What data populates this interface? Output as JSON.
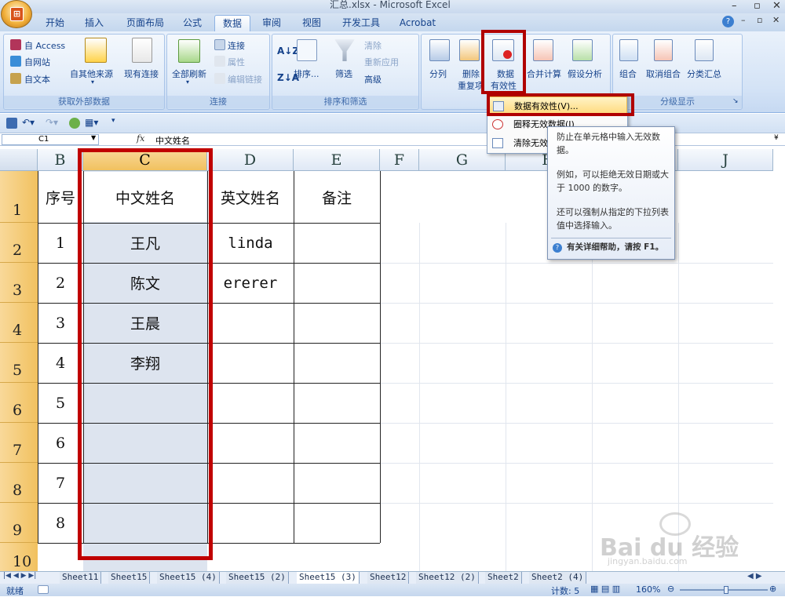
{
  "window": {
    "title": "汇总.xlsx - Microsoft Excel"
  },
  "tabs": [
    "开始",
    "插入",
    "页面布局",
    "公式",
    "数据",
    "审阅",
    "视图",
    "开发工具",
    "Acrobat"
  ],
  "ribbon": {
    "get_external": {
      "label": "获取外部数据",
      "access": "自 Access",
      "web": "自网站",
      "text": "自文本",
      "other": "自其他来源",
      "existing": "现有连接"
    },
    "connections": {
      "label": "连接",
      "refresh_all": "全部刷新",
      "connect": "连接",
      "props": "属性",
      "edit_links": "编辑链接"
    },
    "sort_filter": {
      "label": "排序和筛选",
      "sort": "排序...",
      "filter": "筛选",
      "clear": "清除",
      "reapply": "重新应用",
      "advanced": "高级"
    },
    "data_tools": {
      "split": "分列",
      "remove_dup_1": "删除",
      "remove_dup_2": "重复项",
      "validation_1": "数据",
      "validation_2": "有效性",
      "consolidate": "合并计算",
      "whatif": "假设分析"
    },
    "outline": {
      "label": "分级显示",
      "group": "组合",
      "ungroup": "取消组合",
      "subtotal": "分类汇总"
    }
  },
  "formula_bar": {
    "cell_ref": "C1",
    "fx": "fx",
    "value": "中文姓名"
  },
  "columns": [
    "B",
    "C",
    "D",
    "E",
    "F",
    "G",
    "H",
    "I",
    "J"
  ],
  "rows": [
    "1",
    "2",
    "3",
    "4",
    "5",
    "6",
    "7",
    "8",
    "9",
    "10"
  ],
  "table": {
    "headers": [
      "序号",
      "中文姓名",
      "英文姓名",
      "备注"
    ],
    "rows": [
      [
        "1",
        "王凡",
        "linda",
        ""
      ],
      [
        "2",
        "陈文",
        "ererer",
        ""
      ],
      [
        "3",
        "王晨",
        "",
        ""
      ],
      [
        "4",
        "李翔",
        "",
        ""
      ],
      [
        "5",
        "",
        "",
        ""
      ],
      [
        "6",
        "",
        "",
        ""
      ],
      [
        "7",
        "",
        "",
        ""
      ],
      [
        "8",
        "",
        "",
        ""
      ]
    ]
  },
  "dropdown_menu": {
    "items": [
      "数据有效性(V)...",
      "圈释无效数据(I)",
      "清除无效..."
    ]
  },
  "tooltip": {
    "p1": "防止在单元格中输入无效数据。",
    "p2": "例如，可以拒绝无效日期或大于 1000 的数字。",
    "p3": "还可以强制从指定的下拉列表值中选择输入。",
    "help": "有关详细帮助，请按 F1。"
  },
  "sheets": [
    "Sheet11",
    "Sheet15",
    "Sheet15 (4)",
    "Sheet15 (2)",
    "Sheet15 (3)",
    "Sheet12",
    "Sheet12 (2)",
    "Sheet2",
    "Sheet2 (4)"
  ],
  "active_sheet": "Sheet15 (3)",
  "status": {
    "ready": "就绪",
    "count": "计数: 5",
    "zoom": "160%"
  },
  "watermark": {
    "text": "Bai du 经验",
    "sub": "jingyan.baidu.com"
  }
}
